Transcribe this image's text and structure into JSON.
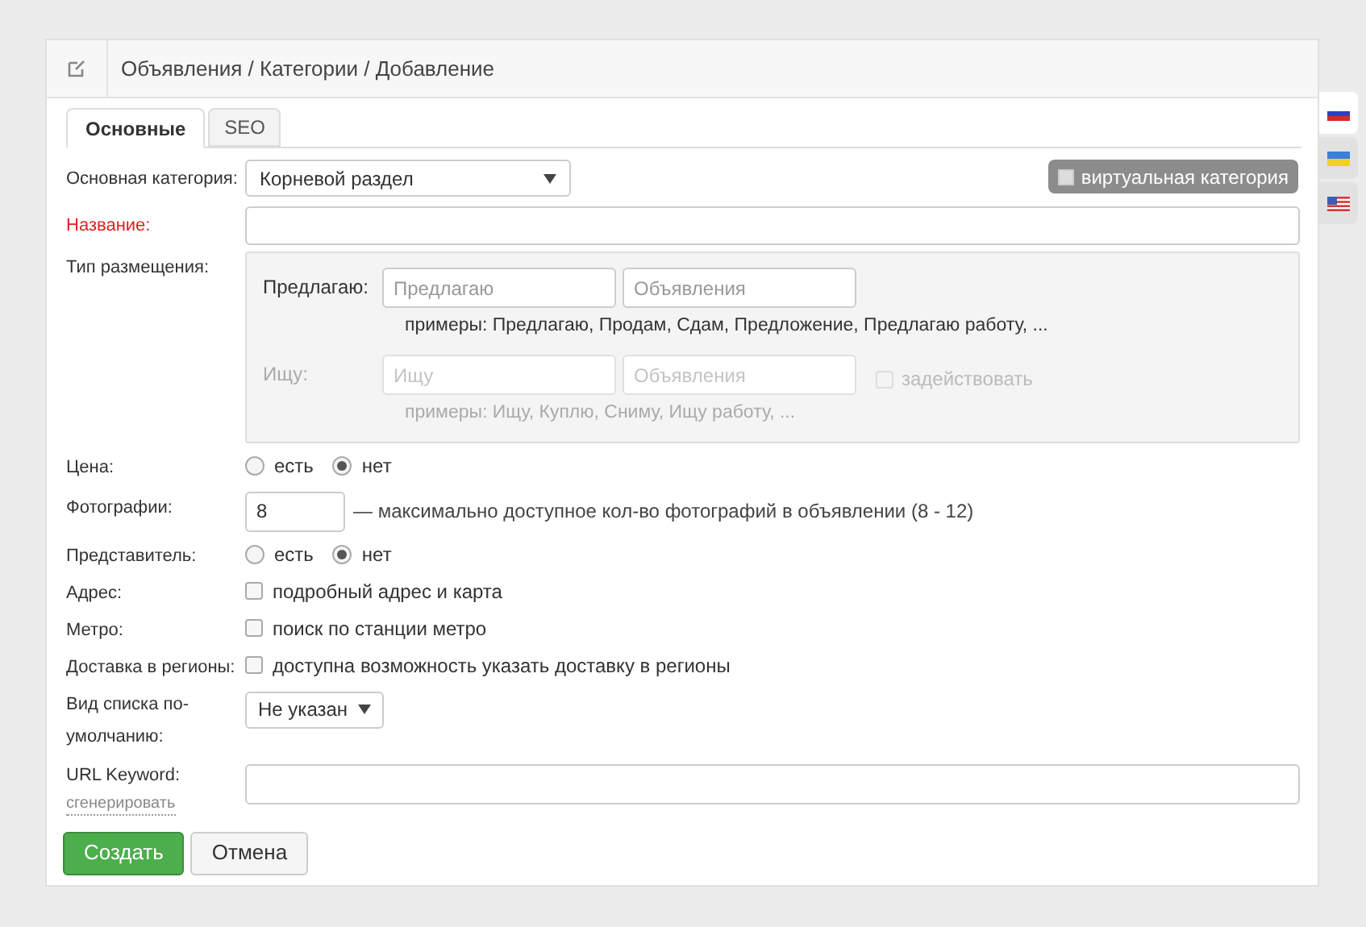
{
  "header": {
    "breadcrumb": "Объявления / Категории / Добавление"
  },
  "languages": [
    {
      "kind": "ru",
      "selected": true
    },
    {
      "kind": "ua",
      "selected": false
    },
    {
      "kind": "us",
      "selected": false
    }
  ],
  "tabs": [
    {
      "label": "Основные",
      "selected": true
    },
    {
      "label": "SEO",
      "selected": false
    }
  ],
  "virtual_category": {
    "label": "виртуальная категория",
    "checked": false
  },
  "fields": [
    {
      "kind": "select",
      "label": "Основная категория:",
      "required": false,
      "value": "Корневой раздел"
    },
    {
      "kind": "text",
      "label": "Название:",
      "required": true
    },
    {
      "kind": "placement",
      "label": "Тип размещения:",
      "required": false,
      "groups": [
        {
          "label": "Предлагаю:",
          "disabled": false,
          "inputs": [
            {
              "placeholder": "Предлагаю"
            },
            {
              "placeholder": "Объявления"
            }
          ],
          "examples": "примеры: Предлагаю, Продам, Сдам, Предложение, Предлагаю работу, ..."
        },
        {
          "label": "Ищу:",
          "disabled": true,
          "inputs": [
            {
              "placeholder": "Ищу"
            },
            {
              "placeholder": "Объявления"
            }
          ],
          "examples": "примеры: Ищу, Куплю, Сниму, Ищу работу, ...",
          "toggle": {
            "label": "задействовать",
            "checked": false
          }
        }
      ]
    },
    {
      "kind": "radio",
      "label": "Цена:",
      "required": false,
      "options": [
        {
          "label": "есть",
          "selected": false
        },
        {
          "label": "нет",
          "selected": true
        }
      ]
    },
    {
      "kind": "number",
      "label": "Фотографии:",
      "required": false,
      "value": "8",
      "hint": "— максимально доступное кол-во фотографий в объявлении (8 - 12)"
    },
    {
      "kind": "radio",
      "label": "Представитель:",
      "required": false,
      "options": [
        {
          "label": "есть",
          "selected": false
        },
        {
          "label": "нет",
          "selected": true
        }
      ]
    },
    {
      "kind": "checkbox",
      "label": "Адрес:",
      "required": false,
      "text": "подробный адрес и карта",
      "checked": false
    },
    {
      "kind": "checkbox",
      "label": "Метро:",
      "required": false,
      "text": "поиск по станции метро",
      "checked": false
    },
    {
      "kind": "checkbox",
      "label": "Доставка в регионы:",
      "required": false,
      "text": "доступна возможность указать доставку в регионы",
      "checked": false
    },
    {
      "kind": "small_select",
      "label": "Вид списка по-умолчанию:",
      "required": false,
      "value": "Не указан"
    },
    {
      "kind": "url",
      "label": "URL Keyword:",
      "required": false,
      "link": "сгенерировать"
    }
  ],
  "buttons": [
    {
      "label": "Создать",
      "kind": "primary"
    },
    {
      "label": "Отмена",
      "kind": "default"
    }
  ]
}
